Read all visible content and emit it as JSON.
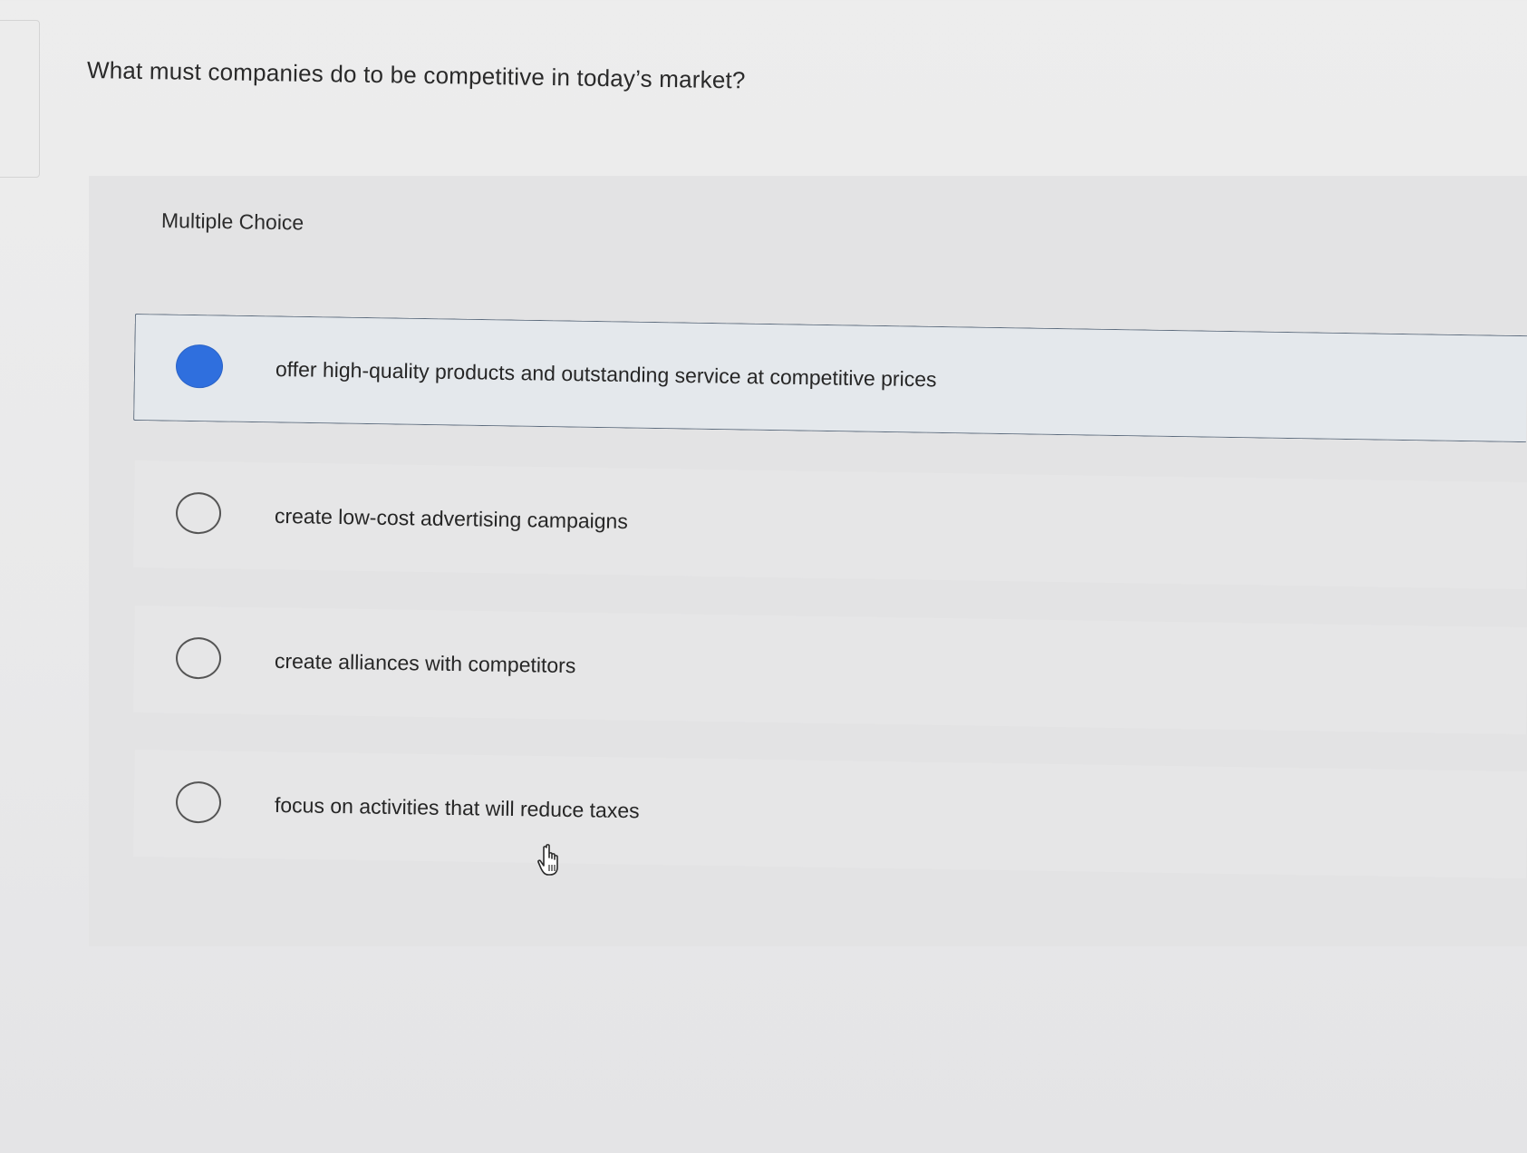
{
  "question": {
    "text": "What must companies do to be competitive in today’s market?"
  },
  "answer_area": {
    "type_label": "Multiple Choice",
    "selected_index": 0,
    "options": [
      {
        "label": "offer high-quality products and outstanding service at competitive prices",
        "selected": true
      },
      {
        "label": "create low-cost advertising campaigns",
        "selected": false
      },
      {
        "label": "create alliances with competitors",
        "selected": false
      },
      {
        "label": "focus on activities that will reduce taxes",
        "selected": false
      }
    ]
  },
  "colors": {
    "selected_radio": "#2f6fde",
    "selected_border": "#5c6b7d",
    "background": "#ededed"
  },
  "icons": {
    "pointer": "hand-pointer-icon"
  }
}
